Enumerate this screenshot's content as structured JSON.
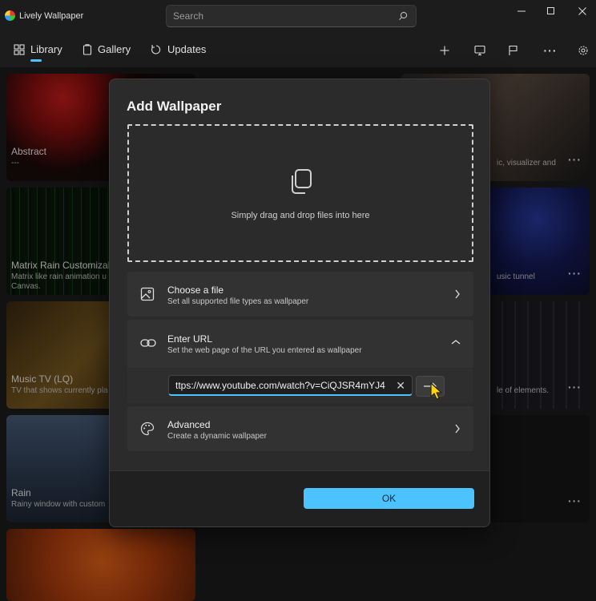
{
  "app": {
    "title": "Lively Wallpaper"
  },
  "search": {
    "placeholder": "Search"
  },
  "nav": {
    "items": [
      {
        "label": "Library",
        "icon": "library-icon"
      },
      {
        "label": "Gallery",
        "icon": "gallery-icon"
      },
      {
        "label": "Updates",
        "icon": "updates-icon"
      }
    ]
  },
  "cards": [
    {
      "title": "Abstract",
      "desc": "---"
    },
    {
      "title": "Matrix Rain Customizal",
      "desc": "Matrix like rain animation u",
      "desc2": "Canvas."
    },
    {
      "title": "Music TV (LQ)",
      "desc": "TV that shows currently pla"
    },
    {
      "title": "Rain",
      "desc": "Rainy window with custom"
    },
    {
      "desc": "ic, visualizer and"
    },
    {
      "desc": "usic tunnel"
    },
    {
      "desc": "le of elements."
    }
  ],
  "dialog": {
    "title": "Add Wallpaper",
    "dropzone_text": "Simply drag and drop files into here",
    "choose": {
      "title": "Choose a file",
      "sub": "Set all supported file types as wallpaper"
    },
    "url": {
      "title": "Enter URL",
      "sub": "Set the web page of the URL you entered as wallpaper",
      "value": "ttps://www.youtube.com/watch?v=CiQJSR4mYJ4"
    },
    "advanced": {
      "title": "Advanced",
      "sub": "Create a dynamic wallpaper"
    },
    "ok": "OK"
  },
  "colors": {
    "accent": "#4cc2ff",
    "cursor": "#ffd400"
  }
}
